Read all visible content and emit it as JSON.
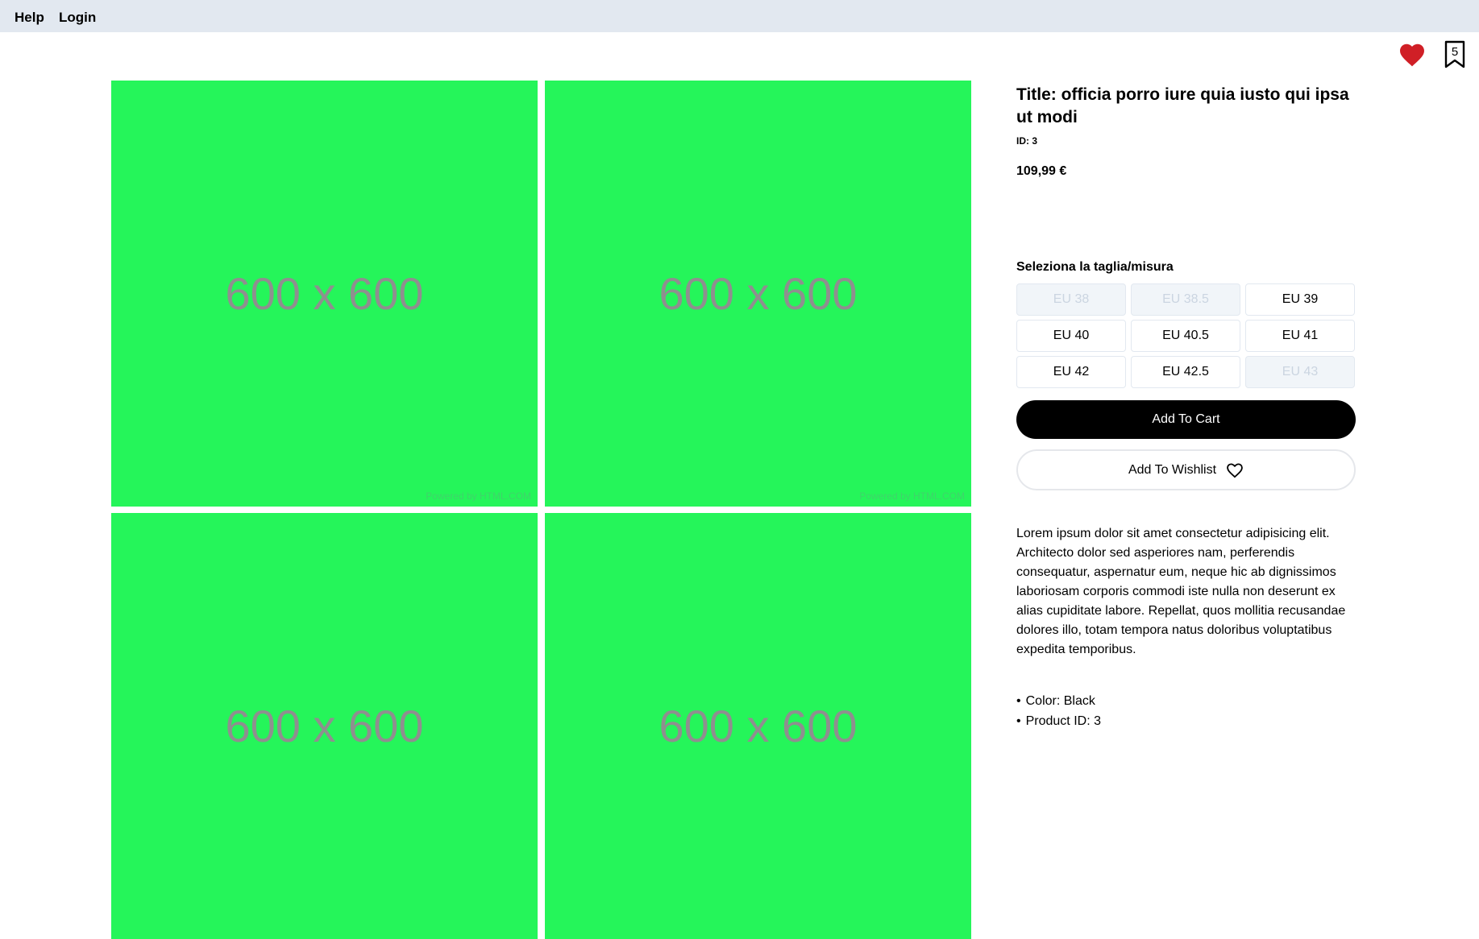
{
  "nav": {
    "help": "Help",
    "login": "Login"
  },
  "header": {
    "favorites_icon": "heart-icon",
    "bookmark_icon": "bookmark-icon",
    "bookmark_count": "5"
  },
  "gallery": {
    "images": [
      {
        "label": "600 x 600",
        "watermark": "Powered by HTML.COM"
      },
      {
        "label": "600 x 600",
        "watermark": "Powered by HTML.COM"
      },
      {
        "label": "600 x 600",
        "watermark": ""
      },
      {
        "label": "600 x 600",
        "watermark": ""
      }
    ]
  },
  "product": {
    "title": "Title: officia porro iure quia iusto qui ipsa ut modi",
    "id_label": "ID: 3",
    "price": "109,99 €"
  },
  "sizes": {
    "label": "Seleziona la taglia/misura",
    "options": [
      {
        "label": "EU 38",
        "available": false
      },
      {
        "label": "EU 38.5",
        "available": false
      },
      {
        "label": "EU 39",
        "available": true
      },
      {
        "label": "EU 40",
        "available": true
      },
      {
        "label": "EU 40.5",
        "available": true
      },
      {
        "label": "EU 41",
        "available": true
      },
      {
        "label": "EU 42",
        "available": true
      },
      {
        "label": "EU 42.5",
        "available": true
      },
      {
        "label": "EU 43",
        "available": false
      }
    ]
  },
  "actions": {
    "add_to_cart": "Add To Cart",
    "add_to_wishlist": "Add To Wishlist",
    "wishlist_icon": "heart-outline-icon"
  },
  "description": "Lorem ipsum dolor sit amet consectetur adipisicing elit. Architecto dolor sed asperiores nam, perferendis consequatur, aspernatur eum, neque hic ab dignissimos laboriosam corporis commodi iste nulla non deserunt ex alias cupiditate labore. Repellat, quos mollitia recusandae dolores illo, totam tempora natus doloribus voluptatibus expedita temporibus.",
  "specs": [
    "Color: Black",
    "Product ID: 3"
  ],
  "colors": {
    "accent_red": "#d01f26",
    "tile_green": "#25f55a",
    "topbar": "#e2e8f0"
  }
}
